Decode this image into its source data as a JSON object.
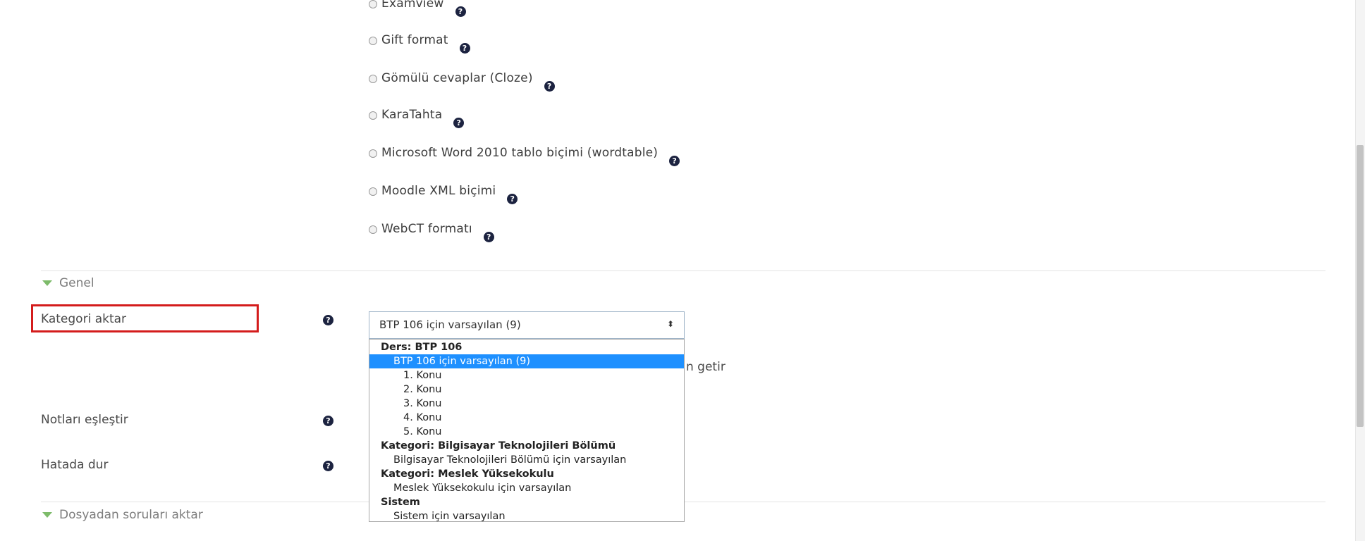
{
  "formats": [
    {
      "label": "Examview"
    },
    {
      "label": "Gift format"
    },
    {
      "label": "Gömülü cevaplar (Cloze)"
    },
    {
      "label": "KaraTahta"
    },
    {
      "label": "Microsoft Word 2010 tablo biçimi (wordtable)"
    },
    {
      "label": "Moodle XML biçimi"
    },
    {
      "label": "WebCT formatı"
    }
  ],
  "help_glyph": "?",
  "sections": {
    "general": "Genel",
    "import_file": "Dosyadan soruları aktar"
  },
  "fields": {
    "category_label": "Kategori aktar",
    "grades_label": "Notları eşleştir",
    "stop_label": "Hatada dur",
    "partial_text": "n getir"
  },
  "select": {
    "value": "BTP 106 için varsayılan (9)",
    "arrows": "⬍"
  },
  "dropdown": [
    {
      "text": "Ders: BTP 106",
      "type": "group"
    },
    {
      "text": "BTP 106 için varsayılan (9)",
      "type": "option",
      "selected": true
    },
    {
      "text": "1. Konu",
      "type": "sub"
    },
    {
      "text": "2. Konu",
      "type": "sub"
    },
    {
      "text": "3. Konu",
      "type": "sub"
    },
    {
      "text": "4. Konu",
      "type": "sub"
    },
    {
      "text": "5. Konu",
      "type": "sub"
    },
    {
      "text": "Kategori: Bilgisayar Teknolojileri Bölümü",
      "type": "group"
    },
    {
      "text": "Bilgisayar Teknolojileri Bölümü için varsayılan",
      "type": "option"
    },
    {
      "text": "Kategori: Meslek Yüksekokulu",
      "type": "group"
    },
    {
      "text": "Meslek Yüksekokulu için varsayılan",
      "type": "option"
    },
    {
      "text": "Sistem",
      "type": "group"
    },
    {
      "text": "Sistem için varsayılan",
      "type": "option"
    }
  ],
  "colors": {
    "highlight": "#d41c1c",
    "selected_bg": "#1e90ff",
    "section_arrow": "#7dbb6a",
    "help_icon": "#1c2340"
  }
}
